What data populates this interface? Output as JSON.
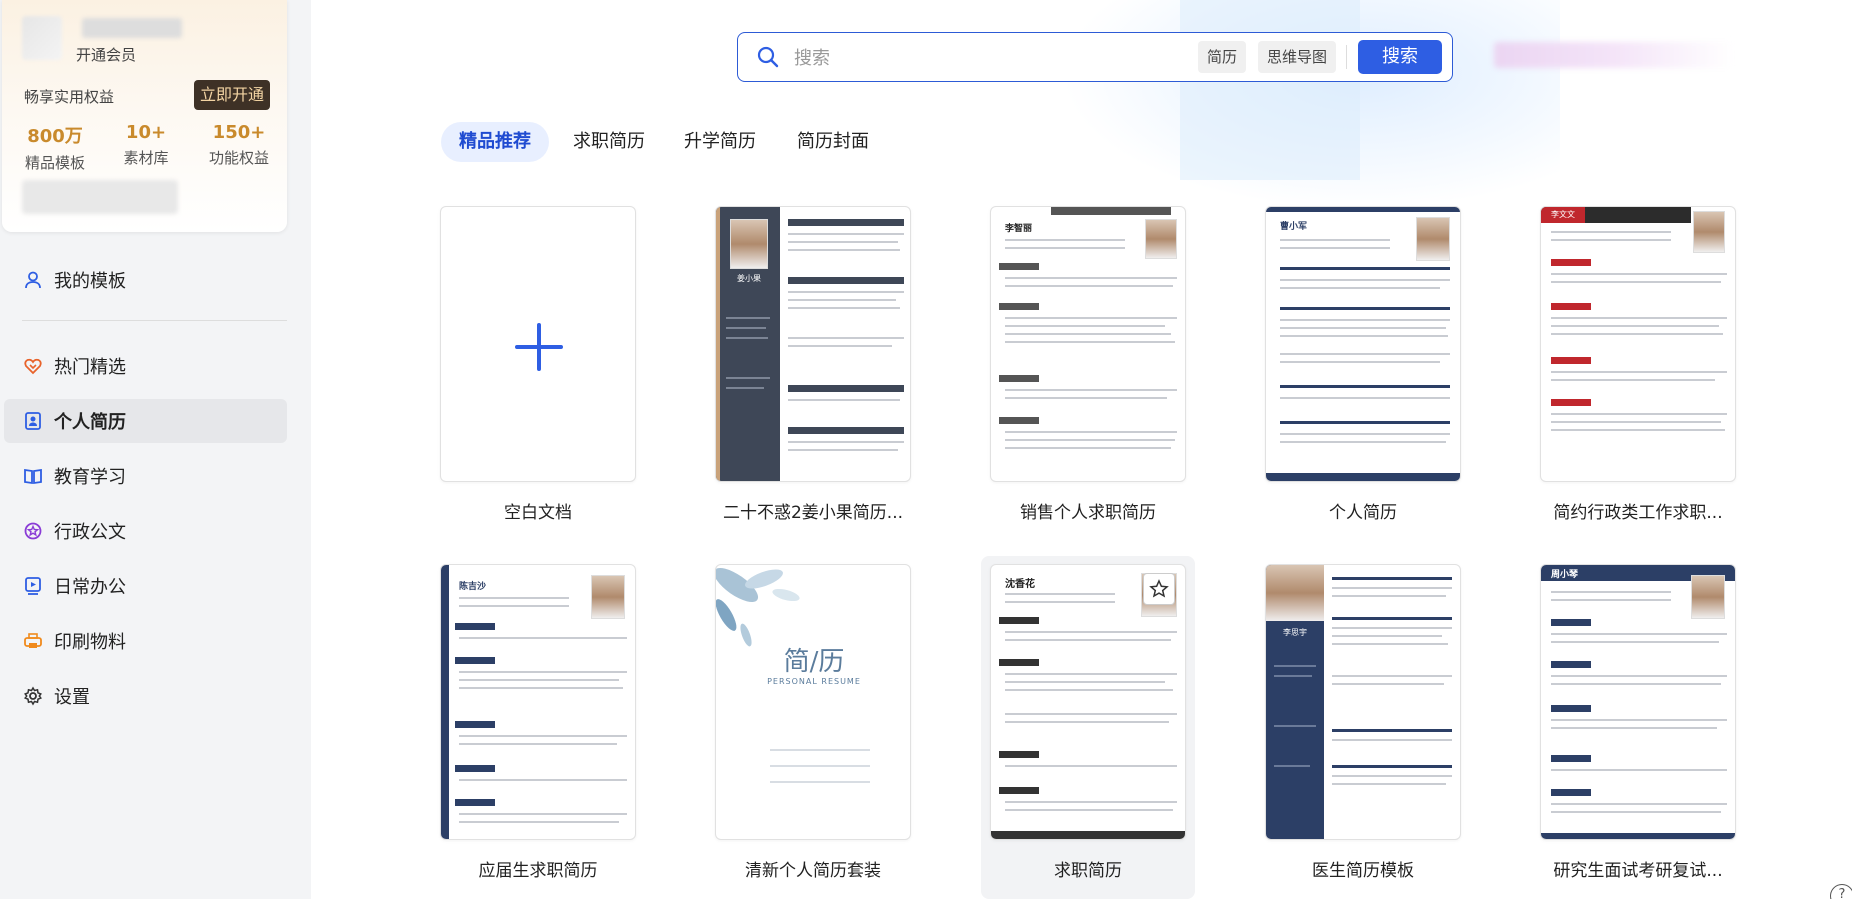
{
  "vip": {
    "status": "开通会员",
    "benefit": "畅享实用权益",
    "button": "立即开通",
    "stats": [
      {
        "value": "800万",
        "label": "精品模板"
      },
      {
        "value": "10+",
        "label": "素材库"
      },
      {
        "value": "150+",
        "label": "功能权益"
      }
    ]
  },
  "nav": {
    "my_templates": "我的模板",
    "items": [
      {
        "label": "热门精选",
        "icon": "heart-badge-icon"
      },
      {
        "label": "个人简历",
        "icon": "resume-icon"
      },
      {
        "label": "教育学习",
        "icon": "book-icon"
      },
      {
        "label": "行政公文",
        "icon": "seal-icon"
      },
      {
        "label": "日常办公",
        "icon": "monitor-play-icon"
      },
      {
        "label": "印刷物料",
        "icon": "printer-icon"
      },
      {
        "label": "设置",
        "icon": "gear-icon"
      }
    ]
  },
  "search": {
    "placeholder": "搜索",
    "chips": [
      "简历",
      "思维导图"
    ],
    "button": "搜索"
  },
  "tabs": [
    "精品推荐",
    "求职简历",
    "升学简历",
    "简历封面"
  ],
  "templates": [
    {
      "title": "空白文档"
    },
    {
      "title": "二十不惑2姜小果简历..."
    },
    {
      "title": "销售个人求职简历"
    },
    {
      "title": "个人简历"
    },
    {
      "title": "简约行政类工作求职..."
    },
    {
      "title": "应届生求职简历"
    },
    {
      "title": "清新个人简历套装"
    },
    {
      "title": "求职简历"
    },
    {
      "title": "医生简历模板"
    },
    {
      "title": "研究生面试考研复试..."
    }
  ],
  "thumb_text": {
    "name_2": "姜小果",
    "name_3": "李智丽",
    "name_4": "曹小军",
    "name_5": "李文文",
    "name_6": "陈吉沙",
    "cover_title": "简/历",
    "cover_sub": "PERSONAL RESUME",
    "name_8": "沈香花",
    "name_9": "李思宇",
    "name_10": "周小琴"
  },
  "help": "?",
  "colors": {
    "accent": "#2e5ee3",
    "vip_gold": "#c98a2c",
    "vip_btn": "#3e3126"
  }
}
